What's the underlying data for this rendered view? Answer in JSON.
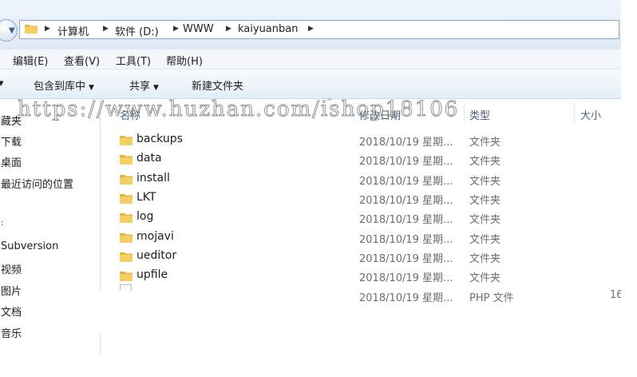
{
  "address": {
    "crumbs": [
      "计算机",
      "软件 (D:)",
      "WWW",
      "kaiyuanban"
    ]
  },
  "menu": [
    "编辑(E)",
    "查看(V)",
    "工具(T)",
    "帮助(H)"
  ],
  "toolbar": {
    "include_library": "包含到库中",
    "share": "共享",
    "new_folder": "新建文件夹"
  },
  "nav": [
    "藏夹",
    "下载",
    "桌面",
    "最近访问的位置",
    "",
    "Subversion",
    "视频",
    "图片",
    "文档",
    "音乐"
  ],
  "columns": {
    "name": "名称",
    "date": "修改日期",
    "type": "类型",
    "size": "大小"
  },
  "files": [
    {
      "name": "backups",
      "date": "2018/10/19 星期...",
      "type": "文件夹",
      "size": ""
    },
    {
      "name": "data",
      "date": "2018/10/19 星期...",
      "type": "文件夹",
      "size": ""
    },
    {
      "name": "install",
      "date": "2018/10/19 星期...",
      "type": "文件夹",
      "size": ""
    },
    {
      "name": "LKT",
      "date": "2018/10/19 星期...",
      "type": "文件夹",
      "size": ""
    },
    {
      "name": "log",
      "date": "2018/10/19 星期...",
      "type": "文件夹",
      "size": ""
    },
    {
      "name": "mojavi",
      "date": "2018/10/19 星期...",
      "type": "文件夹",
      "size": ""
    },
    {
      "name": "ueditor",
      "date": "2018/10/19 星期...",
      "type": "文件夹",
      "size": ""
    },
    {
      "name": "upfile",
      "date": "2018/10/19 星期...",
      "type": "文件夹",
      "size": ""
    },
    {
      "name": "",
      "date": "2018/10/19 星期...",
      "type": "PHP 文件",
      "size": "16"
    }
  ],
  "watermark": "https://www.huzhan.com/ishop18106",
  "colors": {
    "folder": "#e8b53c",
    "address_border": "#8ea6c4",
    "toolbar_bg": "#e4edf7"
  }
}
